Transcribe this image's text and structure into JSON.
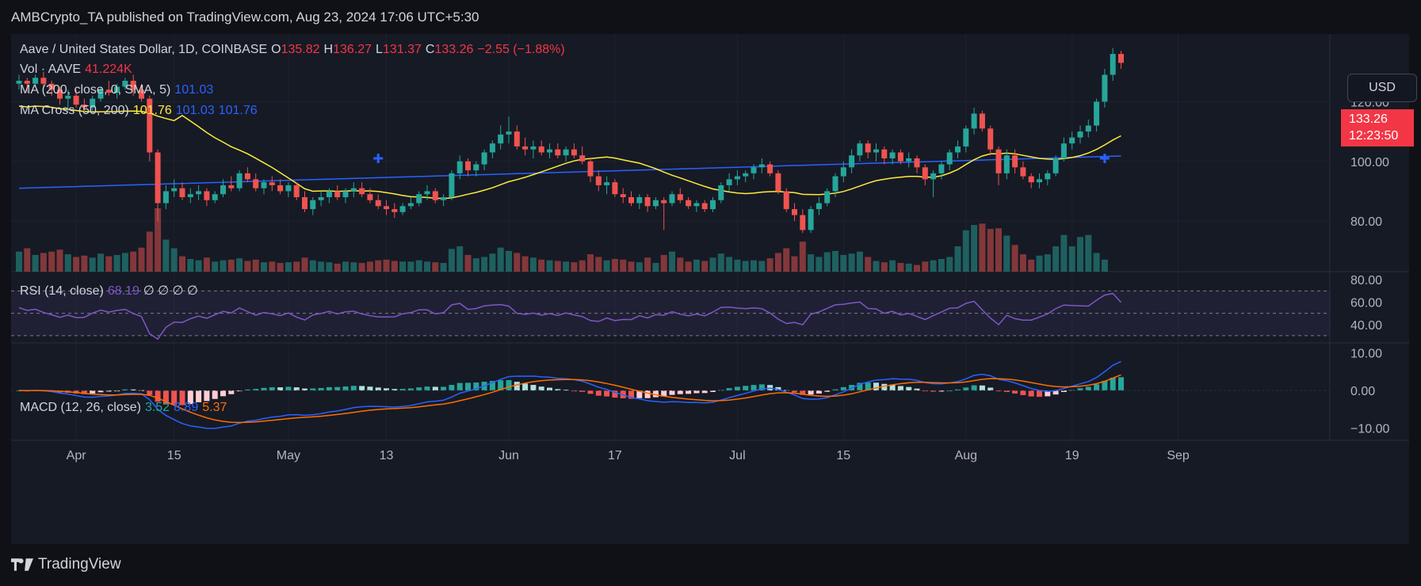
{
  "header": {
    "published": "AMBCrypto_TA published on TradingView.com, Aug 23, 2024 17:06 UTC+5:30"
  },
  "legend": {
    "symbol": "Aave / United States Dollar, 1D, COINBASE",
    "o_label": "O",
    "o": "135.82",
    "h_label": "H",
    "h": "136.27",
    "l_label": "L",
    "l": "131.37",
    "c_label": "C",
    "c": "133.26",
    "change": "−2.55 (−1.88%)",
    "vol_label": "Vol · AAVE",
    "vol": "41.224K",
    "ma_label": "MA (200, close, 0, SMA, 5)",
    "ma": "101.03",
    "cross_label": "MA Cross (50, 200)",
    "cross_a": "101.76",
    "cross_b": "101.03",
    "cross_c": "101.76",
    "rsi_label": "RSI (14, close)",
    "rsi": "68.19",
    "rsi_extra": "∅ ∅ ∅ ∅",
    "macd_label": "MACD (12, 26, close)",
    "macd": "3.52",
    "macd_signal": "8.89",
    "macd_hist": "5.37"
  },
  "currency_button": "USD",
  "price_tag": {
    "price": "133.26",
    "countdown": "12:23:50"
  },
  "brand": "TradingView",
  "colors": {
    "up": "#26a69a",
    "down": "#ef5350",
    "ma200": "#2962ff",
    "ma50": "#ffeb3b",
    "rsi": "#7e57c2",
    "macd": "#2962ff",
    "signal": "#ff6d00"
  },
  "chart_data": {
    "type": "candlestick",
    "x_ticks": [
      "Apr",
      "15",
      "May",
      "13",
      "Jun",
      "17",
      "Jul",
      "15",
      "Aug",
      "19",
      "Sep"
    ],
    "price_axis": {
      "ticks": [
        "120.00",
        "100.00",
        "80.00"
      ],
      "range": [
        75,
        140
      ]
    },
    "rsi_axis": {
      "ticks": [
        "80.00",
        "60.00",
        "40.00"
      ],
      "range": [
        25,
        83
      ],
      "bands": [
        70,
        50,
        30
      ]
    },
    "macd_axis": {
      "ticks": [
        "10.00",
        "0.00",
        "−10.00"
      ],
      "range": [
        -12,
        11
      ]
    },
    "ohlc": [
      [
        126,
        129,
        124,
        127
      ],
      [
        127,
        128,
        123,
        126
      ],
      [
        126,
        129,
        125,
        128
      ],
      [
        128,
        130,
        125,
        126
      ],
      [
        126,
        127,
        122,
        124
      ],
      [
        124,
        125,
        119,
        121
      ],
      [
        121,
        124,
        117,
        122
      ],
      [
        122,
        124,
        118,
        119
      ],
      [
        119,
        121,
        116,
        118
      ],
      [
        118,
        122,
        117,
        121
      ],
      [
        121,
        125,
        120,
        124
      ],
      [
        124,
        127,
        122,
        123
      ],
      [
        123,
        126,
        121,
        125
      ],
      [
        125,
        128,
        124,
        127
      ],
      [
        127,
        129,
        122,
        124
      ],
      [
        124,
        126,
        120,
        121
      ],
      [
        121,
        122,
        100,
        103
      ],
      [
        103,
        104,
        80,
        86
      ],
      [
        86,
        92,
        84,
        90
      ],
      [
        90,
        94,
        88,
        91
      ],
      [
        91,
        93,
        87,
        88
      ],
      [
        88,
        91,
        86,
        89
      ],
      [
        89,
        92,
        87,
        90
      ],
      [
        90,
        91,
        85,
        87
      ],
      [
        87,
        90,
        86,
        89
      ],
      [
        89,
        94,
        88,
        92
      ],
      [
        92,
        95,
        90,
        91
      ],
      [
        91,
        97,
        90,
        96
      ],
      [
        96,
        98,
        93,
        94
      ],
      [
        94,
        96,
        90,
        91
      ],
      [
        91,
        94,
        89,
        93
      ],
      [
        93,
        95,
        90,
        92
      ],
      [
        92,
        94,
        89,
        90
      ],
      [
        90,
        93,
        88,
        92
      ],
      [
        92,
        93,
        87,
        88
      ],
      [
        88,
        90,
        83,
        84
      ],
      [
        84,
        88,
        82,
        87
      ],
      [
        87,
        90,
        85,
        88
      ],
      [
        88,
        91,
        86,
        90
      ],
      [
        90,
        92,
        87,
        88
      ],
      [
        88,
        91,
        86,
        90
      ],
      [
        90,
        93,
        88,
        91
      ],
      [
        91,
        93,
        88,
        89
      ],
      [
        89,
        91,
        86,
        87
      ],
      [
        87,
        89,
        84,
        85
      ],
      [
        85,
        87,
        82,
        84
      ],
      [
        84,
        86,
        81,
        83
      ],
      [
        83,
        86,
        82,
        85
      ],
      [
        85,
        88,
        84,
        86
      ],
      [
        86,
        90,
        85,
        89
      ],
      [
        89,
        92,
        87,
        90
      ],
      [
        90,
        91,
        86,
        87
      ],
      [
        87,
        89,
        85,
        88
      ],
      [
        88,
        97,
        87,
        96
      ],
      [
        96,
        102,
        94,
        100
      ],
      [
        100,
        101,
        95,
        97
      ],
      [
        97,
        100,
        95,
        99
      ],
      [
        99,
        104,
        97,
        103
      ],
      [
        103,
        107,
        101,
        106
      ],
      [
        106,
        112,
        104,
        109
      ],
      [
        109,
        115,
        106,
        110
      ],
      [
        110,
        112,
        104,
        105
      ],
      [
        105,
        108,
        102,
        104
      ],
      [
        104,
        107,
        101,
        105
      ],
      [
        105,
        107,
        102,
        103
      ],
      [
        103,
        106,
        101,
        104
      ],
      [
        104,
        106,
        101,
        102
      ],
      [
        102,
        105,
        100,
        104
      ],
      [
        104,
        106,
        101,
        102
      ],
      [
        102,
        105,
        99,
        100
      ],
      [
        100,
        101,
        93,
        95
      ],
      [
        95,
        97,
        90,
        92
      ],
      [
        92,
        95,
        89,
        93
      ],
      [
        93,
        94,
        88,
        89
      ],
      [
        89,
        91,
        86,
        88
      ],
      [
        88,
        90,
        85,
        86
      ],
      [
        86,
        89,
        84,
        88
      ],
      [
        88,
        89,
        83,
        85
      ],
      [
        85,
        88,
        84,
        87
      ],
      [
        87,
        88,
        77,
        86
      ],
      [
        86,
        90,
        85,
        89
      ],
      [
        89,
        91,
        86,
        87
      ],
      [
        87,
        88,
        84,
        85
      ],
      [
        85,
        87,
        83,
        86
      ],
      [
        86,
        87,
        83,
        84
      ],
      [
        84,
        88,
        83,
        87
      ],
      [
        87,
        93,
        86,
        92
      ],
      [
        92,
        96,
        90,
        94
      ],
      [
        94,
        97,
        92,
        95
      ],
      [
        95,
        97,
        93,
        96
      ],
      [
        96,
        99,
        94,
        98
      ],
      [
        98,
        101,
        96,
        99
      ],
      [
        99,
        100,
        95,
        96
      ],
      [
        96,
        97,
        89,
        90
      ],
      [
        90,
        91,
        83,
        84
      ],
      [
        84,
        86,
        80,
        82
      ],
      [
        82,
        84,
        76,
        77
      ],
      [
        77,
        85,
        76,
        84
      ],
      [
        84,
        88,
        82,
        86
      ],
      [
        86,
        91,
        85,
        90
      ],
      [
        90,
        96,
        88,
        95
      ],
      [
        95,
        100,
        93,
        98
      ],
      [
        98,
        104,
        96,
        102
      ],
      [
        102,
        107,
        100,
        106
      ],
      [
        106,
        107,
        101,
        103
      ],
      [
        103,
        106,
        100,
        104
      ],
      [
        104,
        105,
        99,
        101
      ],
      [
        101,
        104,
        99,
        103
      ],
      [
        103,
        104,
        99,
        100
      ],
      [
        100,
        103,
        98,
        101
      ],
      [
        101,
        102,
        96,
        98
      ],
      [
        98,
        99,
        92,
        94
      ],
      [
        94,
        97,
        88,
        96
      ],
      [
        96,
        100,
        94,
        99
      ],
      [
        99,
        104,
        97,
        103
      ],
      [
        103,
        107,
        101,
        105
      ],
      [
        105,
        112,
        103,
        111
      ],
      [
        111,
        118,
        109,
        116
      ],
      [
        116,
        117,
        110,
        111
      ],
      [
        111,
        112,
        102,
        104
      ],
      [
        104,
        105,
        92,
        96
      ],
      [
        96,
        104,
        94,
        102
      ],
      [
        102,
        104,
        96,
        98
      ],
      [
        98,
        100,
        94,
        95
      ],
      [
        95,
        96,
        91,
        93
      ],
      [
        93,
        96,
        91,
        94
      ],
      [
        94,
        97,
        92,
        96
      ],
      [
        96,
        102,
        95,
        101
      ],
      [
        101,
        108,
        100,
        106
      ],
      [
        106,
        110,
        104,
        108
      ],
      [
        108,
        112,
        106,
        110
      ],
      [
        110,
        114,
        108,
        112
      ],
      [
        112,
        121,
        110,
        120
      ],
      [
        120,
        131,
        118,
        129
      ],
      [
        129,
        138,
        127,
        136
      ],
      [
        136,
        137,
        131,
        133
      ]
    ],
    "volume": [
      30,
      35,
      25,
      28,
      30,
      33,
      26,
      22,
      24,
      21,
      27,
      23,
      25,
      28,
      30,
      36,
      60,
      95,
      48,
      35,
      23,
      19,
      17,
      21,
      15,
      17,
      18,
      20,
      16,
      18,
      14,
      15,
      13,
      14,
      15,
      21,
      17,
      15,
      14,
      12,
      15,
      14,
      13,
      15,
      17,
      18,
      16,
      15,
      15,
      17,
      15,
      14,
      13,
      34,
      38,
      25,
      20,
      22,
      27,
      36,
      31,
      28,
      23,
      21,
      18,
      17,
      16,
      15,
      14,
      17,
      26,
      22,
      17,
      19,
      18,
      15,
      14,
      21,
      13,
      25,
      30,
      21,
      15,
      18,
      16,
      21,
      27,
      22,
      18,
      16,
      17,
      16,
      20,
      28,
      35,
      23,
      45,
      26,
      22,
      29,
      31,
      25,
      27,
      30,
      22,
      16,
      14,
      17,
      13,
      12,
      10,
      15,
      17,
      19,
      22,
      38,
      62,
      70,
      72,
      64,
      65,
      54,
      40,
      26,
      18,
      24,
      26,
      38,
      55,
      38,
      52,
      55,
      28,
      18
    ]
  }
}
